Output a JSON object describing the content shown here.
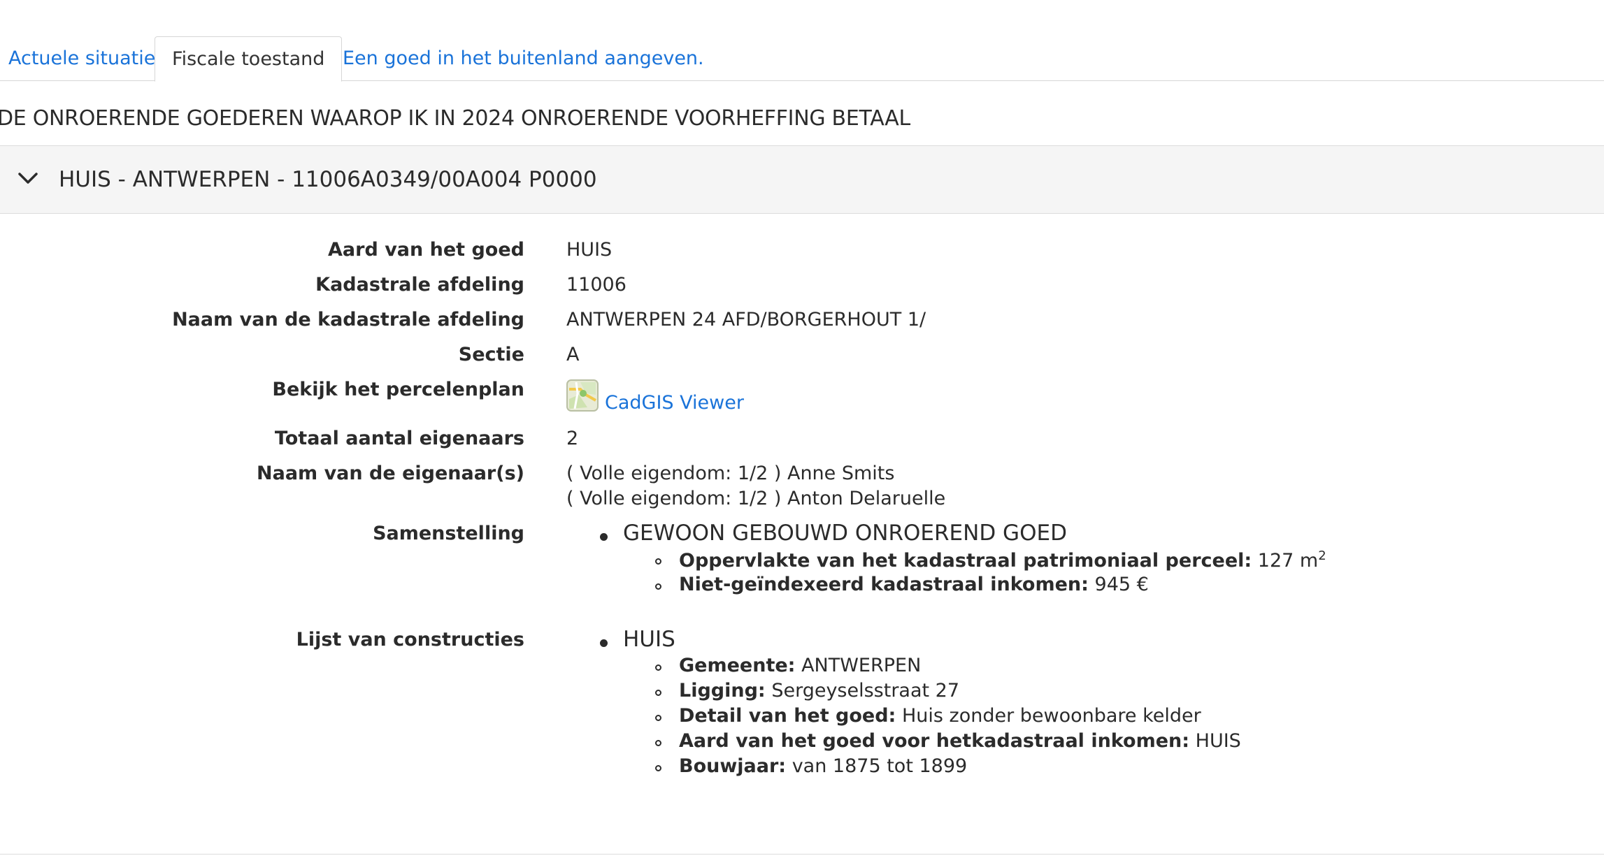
{
  "tabs": [
    {
      "label": "Actuele situatie",
      "active": false
    },
    {
      "label": "Fiscale toestand",
      "active": true
    },
    {
      "label": "Een goed in het buitenland aangeven.",
      "active": false
    }
  ],
  "section_title": "DE ONROERENDE GOEDEREN WAAROP IK IN 2024 ONROERENDE VOORHEFFING BETAAL",
  "property": {
    "header": "HUIS - ANTWERPEN - 11006A0349/00A004 P0000",
    "fields": {
      "aard_label": "Aard van het goed",
      "aard_value": "HUIS",
      "afdeling_label": "Kadastrale afdeling",
      "afdeling_value": "11006",
      "naam_afdeling_label": "Naam van de kadastrale afdeling",
      "naam_afdeling_value": "ANTWERPEN 24 AFD/BORGERHOUT 1/",
      "sectie_label": "Sectie",
      "sectie_value": "A",
      "percelenplan_label": "Bekijk het percelenplan",
      "percelenplan_link": "CadGIS Viewer",
      "eigenaars_label": "Totaal aantal eigenaars",
      "eigenaars_value": "2",
      "naam_eigenaars_label": "Naam van de eigenaar(s)",
      "owners": [
        "( Volle eigendom: 1/2 )  Anne Smits",
        "( Volle eigendom: 1/2 )  Anton Delaruelle"
      ],
      "samenstelling_label": "Samenstelling",
      "samenstelling_item": "GEWOON GEBOUWD ONROEREND GOED",
      "oppervlakte_label": "Oppervlakte van het kadastraal patrimoniaal perceel:",
      "oppervlakte_value": "127 m",
      "oppervlakte_sup": "2",
      "inkomen_label": "Niet-geïndexeerd kadastraal inkomen:",
      "inkomen_value": "945 €",
      "constructies_label": "Lijst van constructies",
      "constructie_item": "HUIS",
      "gemeente_label": "Gemeente:",
      "gemeente_value": "ANTWERPEN",
      "ligging_label": "Ligging:",
      "ligging_value": "Sergeyselsstraat 27",
      "detail_label": "Detail van het goed:",
      "detail_value": "Huis zonder bewoonbare kelder",
      "aard_ki_label": "Aard van het goed voor hetkadastraal inkomen:",
      "aard_ki_value": "HUIS",
      "bouwjaar_label": "Bouwjaar:",
      "bouwjaar_value": "van 1875 tot 1899"
    }
  },
  "icons": {
    "accordion": "chevron-down-icon",
    "viewer": "map-icon"
  },
  "colors": {
    "link": "#1a73d9",
    "header_bg": "#f5f5f5",
    "text": "#2b2b2b"
  }
}
